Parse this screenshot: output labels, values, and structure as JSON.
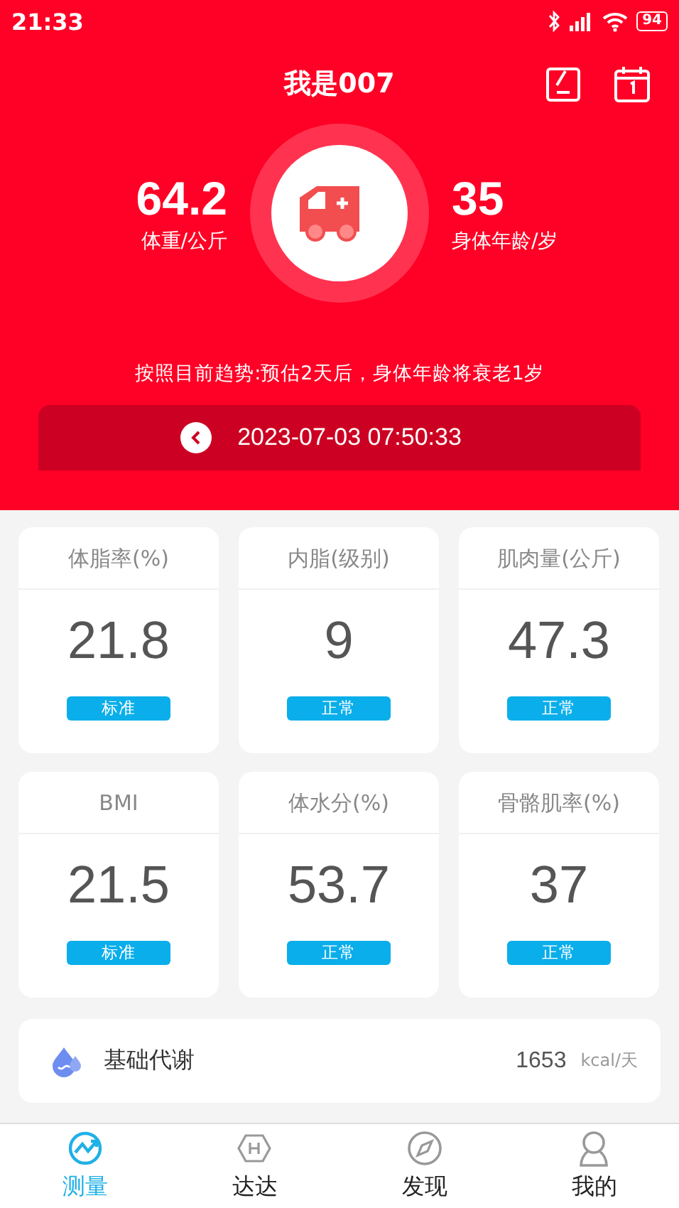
{
  "status_bar": {
    "time": "21:33",
    "battery": "94"
  },
  "header": {
    "title": "我是007"
  },
  "summary": {
    "weight": {
      "value": "64.2",
      "label": "体重/公斤"
    },
    "age": {
      "value": "35",
      "label": "身体年龄/岁"
    },
    "trend": "按照目前趋势:预估2天后，身体年龄将衰老1岁",
    "date": "2023-07-03 07:50:33"
  },
  "metrics": [
    {
      "title": "体脂率(%)",
      "value": "21.8",
      "status": "标准"
    },
    {
      "title": "内脂(级别)",
      "value": "9",
      "status": "正常"
    },
    {
      "title": "肌肉量(公斤)",
      "value": "47.3",
      "status": "正常"
    },
    {
      "title": "BMI",
      "value": "21.5",
      "status": "标准"
    },
    {
      "title": "体水分(%)",
      "value": "53.7",
      "status": "正常"
    },
    {
      "title": "骨骼肌率(%)",
      "value": "37",
      "status": "正常"
    }
  ],
  "metabolism": {
    "label": "基础代谢",
    "value": "1653",
    "unit": "kcal/天"
  },
  "tabs": [
    {
      "label": "测量",
      "kind": "measure",
      "selected": true
    },
    {
      "label": "达达",
      "kind": "hex",
      "selected": false
    },
    {
      "label": "发现",
      "kind": "compass",
      "selected": false
    },
    {
      "label": "我的",
      "kind": "person",
      "selected": false
    }
  ]
}
